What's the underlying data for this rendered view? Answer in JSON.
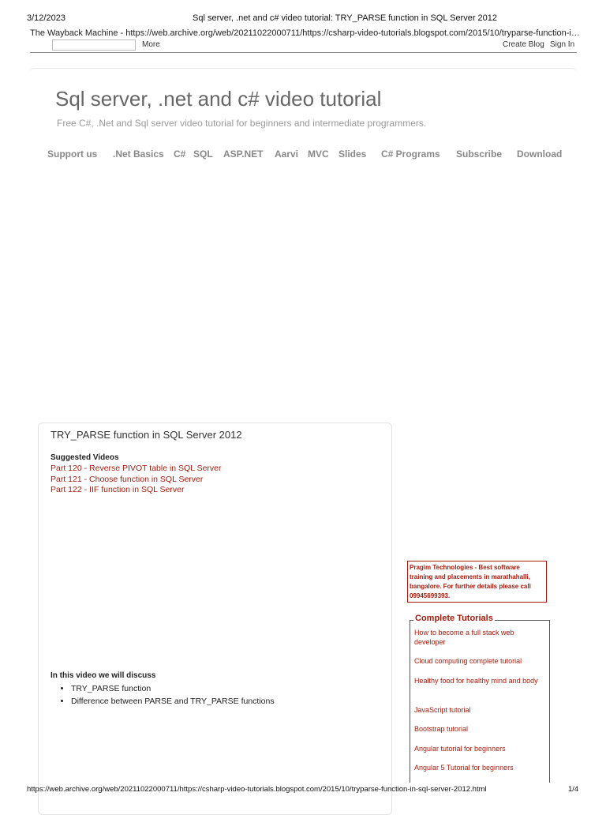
{
  "print_header": {
    "date": "3/12/2023",
    "title": "Sql server, .net and c# video tutorial: TRY_PARSE function in SQL Server 2012",
    "wayback_line": "The Wayback Machine - https://web.archive.org/web/20211022000711/https://csharp-video-tutorials.blogspot.com/2015/10/tryparse-function-in..."
  },
  "navbar": {
    "more": "More",
    "create_blog": "Create Blog",
    "sign_in": "Sign In"
  },
  "blog": {
    "title": "Sql server, .net and c# video tutorial",
    "description": "Free C#, .Net and Sql server video tutorial for beginners and intermediate programmers."
  },
  "nav": {
    "items": [
      "Support us",
      ".Net Basics",
      "C#",
      "SQL",
      "ASP.NET",
      "Aarvi",
      "MVC",
      "Slides",
      "C# Programs",
      "Subscribe",
      "Download"
    ]
  },
  "post": {
    "title": "TRY_PARSE function in SQL Server 2012",
    "suggested_heading": "Suggested Videos",
    "suggested_links": [
      "Part 120 - Reverse PIVOT table in SQL Server",
      "Part 121 - Choose function in SQL Server",
      "Part 122 - IIF function in SQL Server"
    ],
    "discuss_heading": "In this video we will discuss",
    "bullets": [
      "TRY_PARSE function",
      "Difference between PARSE and TRY_PARSE functions"
    ]
  },
  "sidebar": {
    "pragim": "Pragim Technologies - Best software training and placements in marathahalli, bangalore. For further details please call 09945699393.",
    "tutorials_title": "Complete Tutorials",
    "tutorials": [
      "How to become a full stack web developer",
      "Cloud computing complete tutorial",
      "Healthy food for healthy mind and body",
      "JavaScript tutorial",
      "Bootstrap tutorial",
      "Angular tutorial for beginners",
      "Angular 5 Tutorial for beginners"
    ]
  },
  "footer": {
    "url": "https://web.archive.org/web/20211022000711/https://csharp-video-tutorials.blogspot.com/2015/10/tryparse-function-in-sql-server-2012.html",
    "page": "1/4"
  },
  "colors": {
    "link": "#a51c0e",
    "title_gray": "#666666",
    "nav_gray": "#888888"
  }
}
